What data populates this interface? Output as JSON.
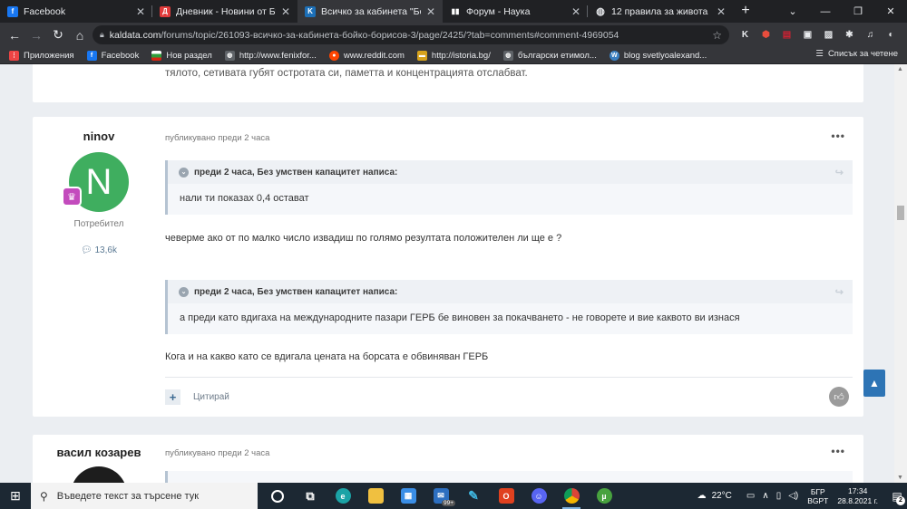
{
  "browser": {
    "tabs": [
      {
        "title": "Facebook",
        "icon": "facebook-icon",
        "color": "#1877f2",
        "glyph": "f",
        "active": false
      },
      {
        "title": "Дневник - Новини от Бълга...",
        "icon": "dnevnik-icon",
        "color": "#e13b3b",
        "glyph": "Д",
        "active": false
      },
      {
        "title": "Всичко за кабинета \"Бойко Б...",
        "icon": "kaldata-icon",
        "color": "#1c6fb7",
        "glyph": "K",
        "active": true
      },
      {
        "title": "Форум - Наука",
        "icon": "forum-icon",
        "color": "#202124",
        "glyph": "▮▮",
        "active": false
      },
      {
        "title": "12 правила за живота",
        "icon": "globe-icon",
        "color": "#202124",
        "glyph": "◍",
        "active": false
      }
    ],
    "new_tab": "+",
    "url_host": "kaldata.com",
    "url_path": "/forums/topic/261093-всичко-за-кабинета-бойко-борисов-3/page/2425/?tab=comments#comment-4969054",
    "bookmarks": [
      {
        "label": "Приложения",
        "icon": "apps-icon",
        "color": "#e44",
        "glyph": "⋮"
      },
      {
        "label": "Facebook",
        "icon": "facebook-icon",
        "color": "#1877f2",
        "glyph": "f"
      },
      {
        "label": "Нов раздел",
        "icon": "flag-bg-icon",
        "color": "#2e9d3a",
        "glyph": ""
      },
      {
        "label": "http://www.fenixfor...",
        "icon": "globe-icon",
        "color": "#5f6368",
        "glyph": "◍"
      },
      {
        "label": "www.reddit.com",
        "icon": "reddit-icon",
        "color": "#ff4500",
        "glyph": "●"
      },
      {
        "label": "http://istoria.bg/",
        "icon": "istoria-icon",
        "color": "#d6a21c",
        "glyph": "▬"
      },
      {
        "label": "български етимол...",
        "icon": "globe-icon",
        "color": "#5f6368",
        "glyph": "◍"
      },
      {
        "label": "blog svetlyoalexand...",
        "icon": "wordpress-icon",
        "color": "#3a7fc1",
        "glyph": "W"
      }
    ],
    "reading_list": "Списък за четене"
  },
  "prev_post": {
    "text": "тялото, сетивата губят остротата си, паметта и концентрацията отслабват."
  },
  "post": {
    "author": "ninov",
    "avatar_letter": "N",
    "role": "Потребител",
    "reputation": "13,6k",
    "published": "публикувано преди 2 часа",
    "quote1": {
      "header": "преди 2 часа, Без умствен капацитет написа:",
      "body": "нали ти показах 0,4 остават"
    },
    "reply1": "чеверме ако от по малко число извадиш по голямо резултата положителен ли ще е ?",
    "quote2": {
      "header": "преди 2 часа, Без умствен капацитет написа:",
      "body": "а преди като вдигаха на международните пазари ГЕРБ бе виновен за покачването - не говорете и вие каквото ви изнася"
    },
    "reply2": "Кога и на какво като се вдигала цената на борсата е обвиняван ГЕРБ",
    "quote_button": "Цитирай"
  },
  "next_post": {
    "author": "васил козарев",
    "published": "публикувано преди 2 часа"
  },
  "taskbar": {
    "search_placeholder": "Въведете текст за търсене тук",
    "mail_badge": "99+",
    "temperature": "22°C",
    "lang_line1": "БГР",
    "lang_line2": "BGPT",
    "time": "17:34",
    "date": "28.8.2021 г.",
    "notifications": "2"
  }
}
